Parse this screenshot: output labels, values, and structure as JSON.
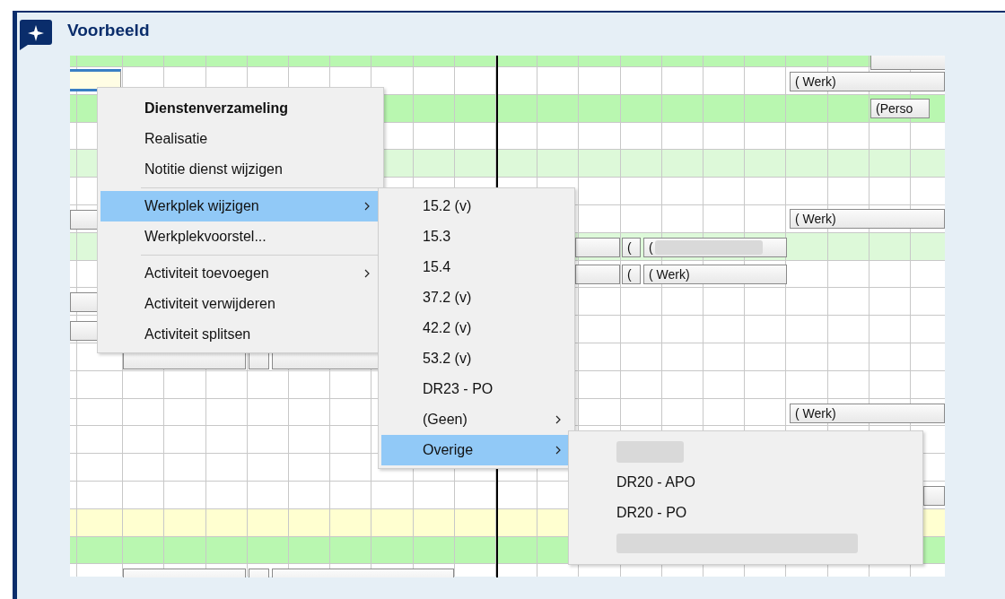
{
  "callout": {
    "title": "Voorbeeld"
  },
  "screenshot": {
    "rows": [
      {
        "color": "#b9f7b0"
      },
      {
        "color": "#ffffff"
      },
      {
        "color": "#b9f7b0"
      },
      {
        "color": "#ffffff"
      },
      {
        "color": "#ddf9d9"
      },
      {
        "color": "#ffffff"
      },
      {
        "color": "#ffffff"
      },
      {
        "color": "#ddf9d9"
      },
      {
        "color": "#ffffff"
      },
      {
        "color": "#ffffff"
      },
      {
        "color": "#ffffff"
      },
      {
        "color": "#ffffff"
      },
      {
        "color": "#ffffff"
      },
      {
        "color": "#ffffff"
      },
      {
        "color": "#ffffff"
      },
      {
        "color": "#ffffff"
      },
      {
        "color": "#ffffff"
      },
      {
        "color": "#ffffd0"
      },
      {
        "color": "#b9f7b0"
      },
      {
        "color": "#ffffff"
      }
    ],
    "bars": [
      {
        "label": "( Werk)"
      },
      {
        "label": "(Perso"
      },
      {
        "label": "( Werk)"
      },
      {
        "label": "("
      },
      {
        "label": "(",
        "redacted": true
      },
      {
        "label": "("
      },
      {
        "label": "( Werk)"
      },
      {
        "label": "( Werk)"
      }
    ],
    "context_menu": {
      "items": [
        {
          "kind": "item",
          "label": "Dienstenverzameling",
          "default": true,
          "submenu": false,
          "selected": false
        },
        {
          "kind": "item",
          "label": "Realisatie",
          "default": false,
          "submenu": false,
          "selected": false
        },
        {
          "kind": "item",
          "label": "Notitie dienst wijzigen",
          "default": false,
          "submenu": false,
          "selected": false
        },
        {
          "kind": "separator"
        },
        {
          "kind": "item",
          "label": "Werkplek wijzigen",
          "default": false,
          "submenu": true,
          "selected": true
        },
        {
          "kind": "item",
          "label": "Werkplekvoorstel...",
          "default": false,
          "submenu": false,
          "selected": false
        },
        {
          "kind": "separator"
        },
        {
          "kind": "item",
          "label": "Activiteit toevoegen",
          "default": false,
          "submenu": true,
          "selected": false
        },
        {
          "kind": "item",
          "label": "Activiteit verwijderen",
          "default": false,
          "submenu": false,
          "selected": false
        },
        {
          "kind": "item",
          "label": "Activiteit splitsen",
          "default": false,
          "submenu": false,
          "selected": false
        }
      ]
    },
    "submenu": {
      "items": [
        {
          "kind": "item",
          "label": "15.2 (v)",
          "submenu": false,
          "selected": false
        },
        {
          "kind": "item",
          "label": "15.3",
          "submenu": false,
          "selected": false
        },
        {
          "kind": "item",
          "label": "15.4",
          "submenu": false,
          "selected": false
        },
        {
          "kind": "item",
          "label": "37.2 (v)",
          "submenu": false,
          "selected": false
        },
        {
          "kind": "item",
          "label": "42.2 (v)",
          "submenu": false,
          "selected": false
        },
        {
          "kind": "item",
          "label": "53.2 (v)",
          "submenu": false,
          "selected": false
        },
        {
          "kind": "item",
          "label": "DR23 - PO",
          "submenu": false,
          "selected": false
        },
        {
          "kind": "item",
          "label": "(Geen)",
          "submenu": true,
          "selected": false
        },
        {
          "kind": "item",
          "label": "Overige",
          "submenu": true,
          "selected": true
        }
      ]
    },
    "sub_submenu": {
      "items": [
        {
          "kind": "redacted"
        },
        {
          "kind": "item",
          "label": "DR20 - APO",
          "submenu": false,
          "selected": false
        },
        {
          "kind": "item",
          "label": "DR20 - PO",
          "submenu": false,
          "selected": false
        },
        {
          "kind": "redacted"
        }
      ]
    }
  }
}
